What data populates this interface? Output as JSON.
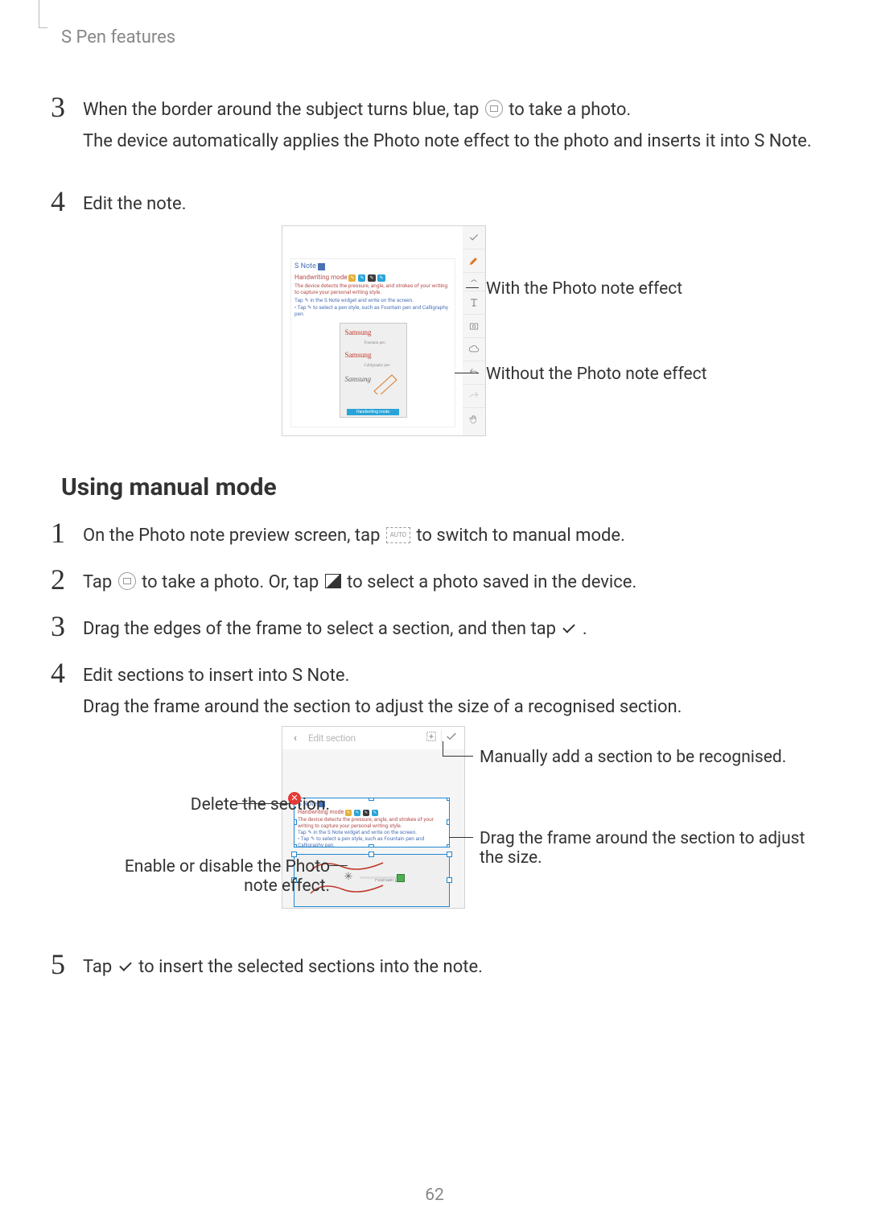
{
  "header": {
    "section_title": "S Pen features"
  },
  "steps_a": {
    "s3": {
      "num": "3",
      "line1a": "When the border around the subject turns blue, tap ",
      "line1b": " to take a photo.",
      "line2": "The device automatically applies the Photo note effect to the photo and inserts it into S Note."
    },
    "s4": {
      "num": "4",
      "line1": "Edit the note."
    }
  },
  "fig1": {
    "callout_with": "With the Photo note effect",
    "callout_without": "Without the Photo note effect",
    "note": {
      "title": "S Note",
      "hw_label": "Handwriting mode",
      "desc1": "The device detects the pressure, angle, and strokes of your writing to capture your personal writing style.",
      "desc2": "Tap ✎ in the S Note widget and write on the screen.",
      "desc3": "• Tap ✎ to select a pen style, such as Fountain pen and Calligraphy pen.",
      "photo_bottom": "Handwriting mode",
      "photo_pen1": "Fountain pen",
      "photo_pen2": "Calligraphy pen"
    }
  },
  "heading2": "Using manual mode",
  "steps_b": {
    "s1": {
      "num": "1",
      "a": "On the Photo note preview screen, tap ",
      "b": " to switch to manual mode."
    },
    "s2": {
      "num": "2",
      "a": "Tap ",
      "b": " to take a photo. Or, tap ",
      "c": " to select a photo saved in the device."
    },
    "s3": {
      "num": "3",
      "a": "Drag the edges of the frame to select a section, and then tap ",
      "b": "."
    },
    "s4": {
      "num": "4",
      "line1": "Edit sections to insert into S Note.",
      "line2": "Drag the frame around the section to adjust the size of a recognised section."
    },
    "s5": {
      "num": "5",
      "a": "Tap ",
      "b": " to insert the selected sections into the note."
    }
  },
  "fig2": {
    "header_title": "Edit section",
    "left1": "Delete the section.",
    "left2": "Enable or disable the Photo note effect.",
    "right1": "Manually add a section to be recognised.",
    "right2": "Drag the frame around the section to adjust the size.",
    "sec1": {
      "title": "S Note",
      "hw_label": "Handwriting mode",
      "desc1": "The device detects the pressure, angle, and strokes of your writing to capture your personal writing style.",
      "desc2": "Tap ✎ in the S Note widget and write on the screen.",
      "desc3": "• Tap ✎ to select a pen style, such as Fountain pen and Calligraphy pen."
    },
    "sec2": {
      "pen_label": "Fountain pen"
    }
  },
  "icons": {
    "auto_text": "AUTO"
  },
  "page_number": "62"
}
